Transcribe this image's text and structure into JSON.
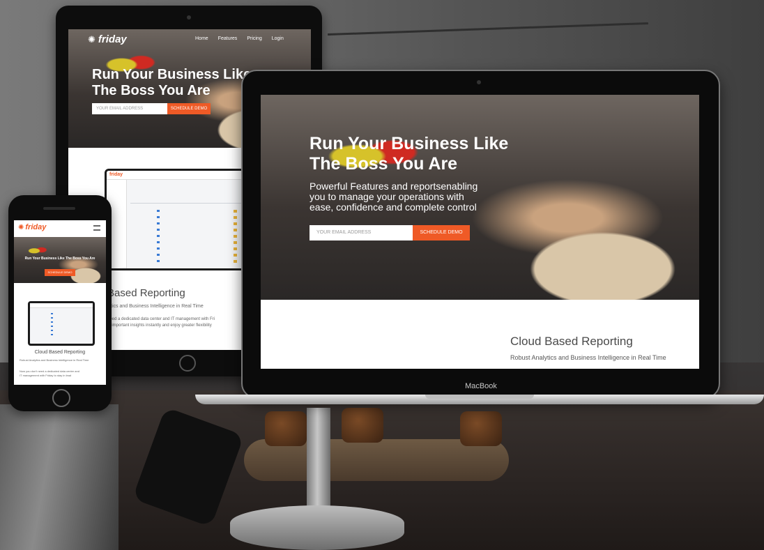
{
  "laptop": {
    "brand": "MacBook",
    "headline_line1": "Run Your Business Like",
    "headline_line2": "The Boss You Are",
    "subtext_line1": "Powerful Features and reportsenabling",
    "subtext_line2": "you to manage your operations with",
    "subtext_line3": "ease, confidence and complete control",
    "email_placeholder": "YOUR EMAIL ADDRESS",
    "cta_label": "SCHEDULE DEMO",
    "section_title": "Cloud Based Reporting",
    "section_subtitle": "Robust Analytics and Business Intelligence in Real Time"
  },
  "tablet": {
    "logo": "friday",
    "nav": [
      "Home",
      "Features",
      "Pricing",
      "Login"
    ],
    "headline_line1": "Run Your Business Like",
    "headline_line2": "The Boss You Are",
    "email_placeholder": "YOUR EMAIL ADDRESS",
    "cta_label": "SCHEDULE DEMO",
    "section_title": "Based Reporting",
    "section_subtitle": "lytics and Business Intelligence in Real Time",
    "body_line1": "need a dedicated data center and IT management with Fri",
    "body_line2": "st important insights instantly and enjoy greater flexibility"
  },
  "phone": {
    "logo": "friday",
    "headline": "Run Your Business Like The Boss You Are",
    "cta_label": "SCHEDULE DEMO",
    "section_title": "Cloud Based Reporting",
    "section_subtitle": "Robust Analytics and Business Intelligence in Real Time",
    "body_line1": "Now you don't need a dedicated data center and",
    "body_line2": "IT management with Friday to stay in lead"
  },
  "colors": {
    "accent": "#ef5a26",
    "device": "#0d0d0d"
  }
}
